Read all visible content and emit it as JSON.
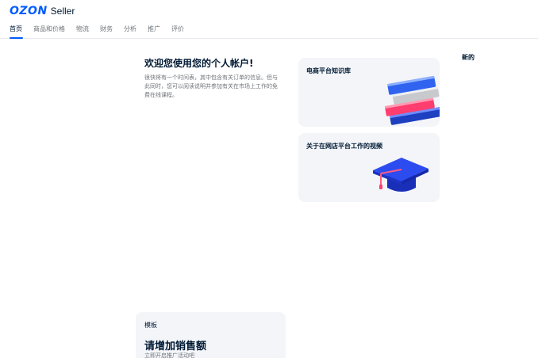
{
  "header": {
    "logo_brand": "OZON",
    "logo_product": "Seller",
    "brand_color": "#005bff"
  },
  "nav": {
    "items": [
      {
        "label": "首页",
        "active": true
      },
      {
        "label": "商品和价格",
        "active": false
      },
      {
        "label": "物流",
        "active": false
      },
      {
        "label": "财务",
        "active": false
      },
      {
        "label": "分析",
        "active": false
      },
      {
        "label": "推广",
        "active": false
      },
      {
        "label": "评价",
        "active": false
      }
    ]
  },
  "welcome": {
    "title": "欢迎您使用您的个人帐户!",
    "text": "很快将有一个时间表，其中包含有关订单的信息。但与此同时，您可以阅读说明并参加有关在市场上工作的免费在线课程。"
  },
  "cards": {
    "knowledge_base": {
      "title": "电商平台知识库",
      "icon": "books-icon"
    },
    "video": {
      "title": "关于在网店平台工作的视频",
      "icon": "graduation-cap-icon"
    }
  },
  "news": {
    "title": "新的"
  },
  "template": {
    "label": "模板",
    "headline": "请增加销售额",
    "subtitle": "立即开启推广活动吧"
  }
}
